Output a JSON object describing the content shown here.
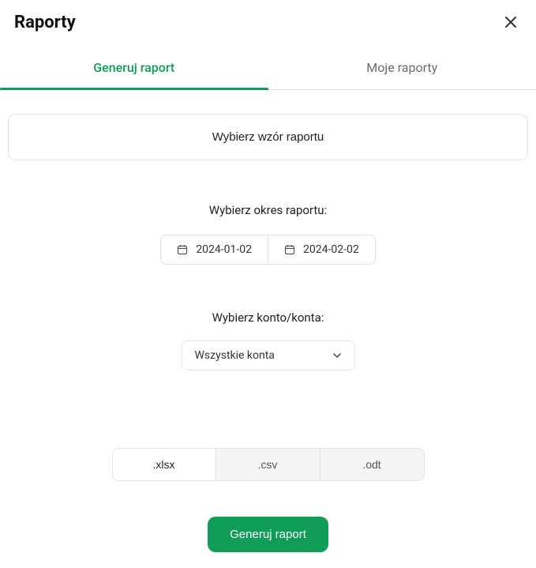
{
  "header": {
    "title": "Raporty"
  },
  "tabs": {
    "generate": "Generuj raport",
    "myreports": "Moje raporty"
  },
  "template": {
    "button_label": "Wybierz wzór raportu"
  },
  "period": {
    "label": "Wybierz okres raportu:",
    "date_from": "2024-01-02",
    "date_to": "2024-02-02"
  },
  "accounts": {
    "label": "Wybierz konto/konta:",
    "selected": "Wszystkie konta"
  },
  "formats": {
    "xlsx": ".xlsx",
    "csv": ".csv",
    "odt": ".odt"
  },
  "footer": {
    "generate_label": "Generuj raport"
  }
}
